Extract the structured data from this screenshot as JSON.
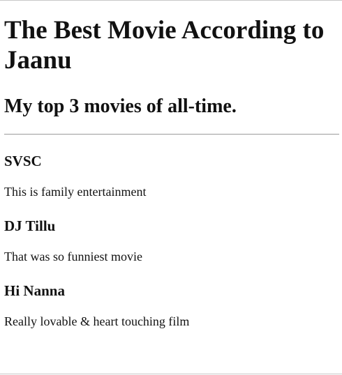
{
  "page": {
    "title": "The Best Movie According to Jaanu",
    "subtitle": "My top 3 movies of all-time."
  },
  "movies": [
    {
      "title": "SVSC",
      "description": "This is family entertainment"
    },
    {
      "title": "DJ Tillu",
      "description": "That was so funniest movie"
    },
    {
      "title": "Hi Nanna",
      "description": "Really lovable & heart touching film"
    }
  ]
}
